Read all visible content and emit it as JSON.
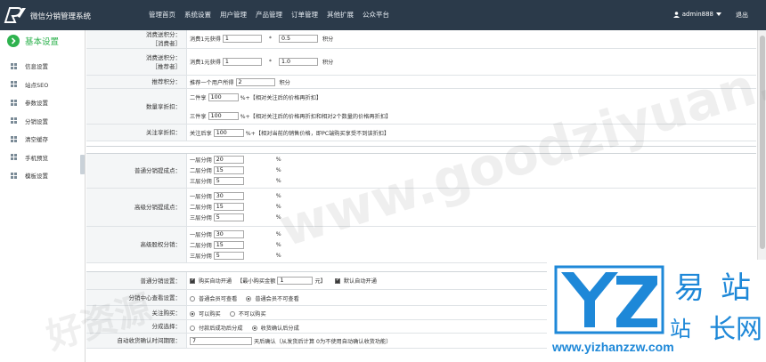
{
  "header": {
    "brand": "微信分销管理系统",
    "nav": [
      "管理首页",
      "系统设置",
      "用户管理",
      "产品管理",
      "订单管理",
      "其他扩展",
      "公众平台"
    ],
    "user": "admin888",
    "logout": "退出"
  },
  "sidebar": {
    "title": "基本设置",
    "items": [
      "信息设置",
      "站点SEO",
      "参数设置",
      "分销设置",
      "清空缓存",
      "手机预览",
      "模板设置"
    ]
  },
  "form": {
    "consume_points_consumer": {
      "label_line1": "消费送积分：",
      "label_line2": "［消费者］",
      "prefix": "消费1元获得",
      "value1": "1",
      "op": "*",
      "value2": "0.5",
      "suffix": "积分"
    },
    "consume_points_referrer": {
      "label_line1": "消费送积分：",
      "label_line2": "［推荐者］",
      "prefix": "消费1元获得",
      "value1": "1",
      "op": "*",
      "value2": "1.0",
      "suffix": "积分"
    },
    "recommend_points": {
      "label": "推荐积分：",
      "prefix": "推荐一个用户所得",
      "value": "2",
      "suffix": "积分"
    },
    "quantity_discount": {
      "label": "数量享折扣：",
      "line1_prefix": "二件享",
      "line1_value": "100",
      "line1_suffix": "%+【相对关注后的价格再折扣】",
      "line2_prefix": "三件享",
      "line2_value": "100",
      "line2_suffix": "%+【相对关注后的价格再折扣和相对2个数量的价格再折扣】"
    },
    "follow_discount": {
      "label": "关注享折扣：",
      "prefix": "关注后享",
      "value": "100",
      "suffix": "%+【相对当前的销售价格，即PC端购买享受不到该折扣】"
    },
    "normal_commission": {
      "label": "普通分销提成点：",
      "rows": [
        {
          "prefix": "一层分佣",
          "value": "20",
          "suffix": "%"
        },
        {
          "prefix": "二层分佣",
          "value": "15",
          "suffix": "%"
        },
        {
          "prefix": "三层分佣",
          "value": "5",
          "suffix": "%"
        }
      ]
    },
    "senior_commission": {
      "label": "高级分销提成点：",
      "rows": [
        {
          "prefix": "一层分佣",
          "value": "30",
          "suffix": "%"
        },
        {
          "prefix": "二层分佣",
          "value": "15",
          "suffix": "%"
        },
        {
          "prefix": "三层分佣",
          "value": "5",
          "suffix": "%"
        }
      ]
    },
    "senior_share": {
      "label": "高级股权分销：",
      "rows": [
        {
          "prefix": "一层分佣",
          "value": "30",
          "suffix": "%"
        },
        {
          "prefix": "二层分佣",
          "value": "15",
          "suffix": "%"
        },
        {
          "prefix": "三层分佣",
          "value": "5",
          "suffix": "%"
        }
      ]
    },
    "normal_open": {
      "label": "普通分销设置：",
      "check1": "购买自动开通",
      "min_prefix": "【最小购买金额",
      "min_value": "1",
      "min_suffix": "元】",
      "check2": "默认自动开通"
    },
    "center_view": {
      "label": "分销中心查看设置：",
      "opt1": "普通会员可查看",
      "opt2": "普通会员不可查看"
    },
    "follow_buy": {
      "label": "关注购买：",
      "opt1": "可以购买",
      "opt2": "不可以购买"
    },
    "settle": {
      "label": "分成选择：",
      "opt1": "付款后成功后分成",
      "opt2": "收货确认后分成"
    },
    "auto_confirm": {
      "label": "自动收货确认时间期限：",
      "value": "7",
      "suffix": "天后确认（从发货后计算 0为不使用自动确认收货功能）"
    }
  },
  "watermark": {
    "main": "www.goodziyuan.com",
    "secondary": "好资源"
  },
  "badge": {
    "letters": "YZ",
    "cn": [
      "易",
      "站",
      "站",
      "长",
      "网"
    ],
    "url": "www.yizhanzzw.com"
  },
  "colors": {
    "topbar": "#2b3a4a",
    "accent": "#2eb24e",
    "badge": "#1e88d8"
  }
}
